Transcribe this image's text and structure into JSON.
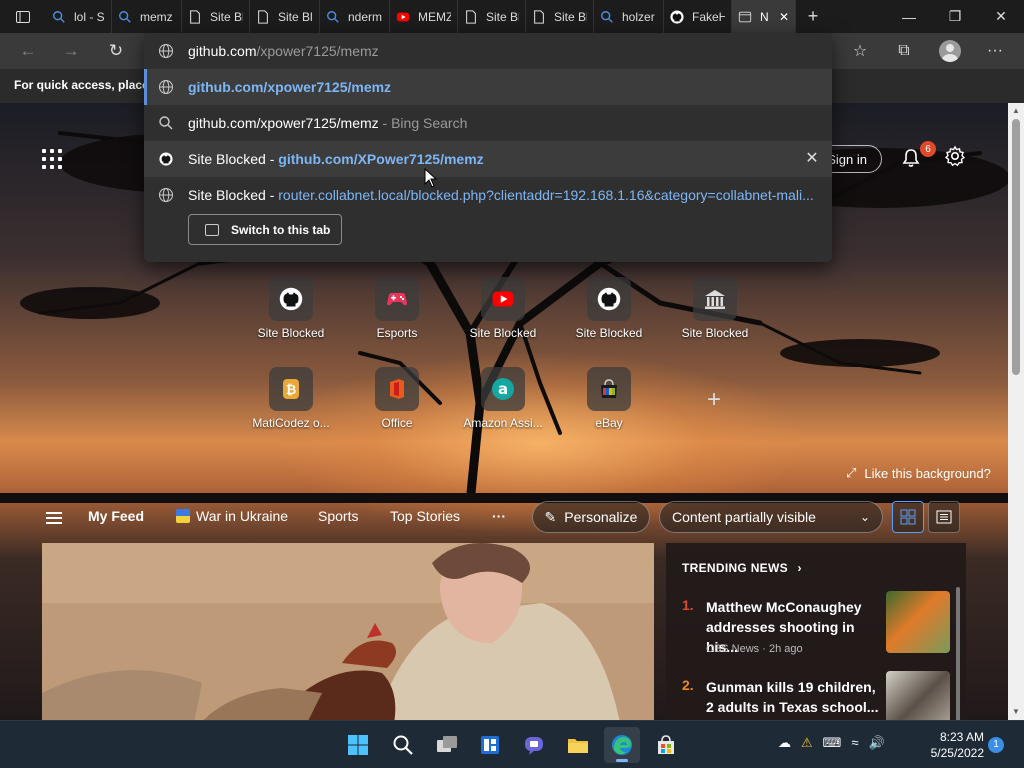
{
  "tabs": [
    {
      "title": "lol - S",
      "icon": "search-icon"
    },
    {
      "title": "memz",
      "icon": "search-icon"
    },
    {
      "title": "Site Bl",
      "icon": "page-icon"
    },
    {
      "title": "Site Bl",
      "icon": "page-icon"
    },
    {
      "title": "nderm",
      "icon": "search-icon"
    },
    {
      "title": "MEMZ",
      "icon": "youtube-icon"
    },
    {
      "title": "Site Bl",
      "icon": "page-icon"
    },
    {
      "title": "Site Bl",
      "icon": "page-icon"
    },
    {
      "title": "holzer",
      "icon": "search-icon"
    },
    {
      "title": "FakeH",
      "icon": "github-icon"
    },
    {
      "title": "N",
      "icon": "newtab-icon",
      "active": true
    }
  ],
  "addressbar": {
    "domain": "github.com",
    "path": "/xpower7125/memz"
  },
  "favorites_bar": {
    "message": "For quick access, place y"
  },
  "suggestions": [
    {
      "text": "github.com/xpower7125/memz",
      "icon": "globe-icon"
    },
    {
      "text": "github.com/xpower7125/memz",
      "suffix": " - Bing Search",
      "icon": "search-icon"
    },
    {
      "prefix": "Site Blocked - ",
      "link": "github.com/XPower7125/memz",
      "icon": "github-icon"
    },
    {
      "prefix": "Site Blocked - ",
      "link": "router.collabnet.local/blocked.php?clientaddr=192.168.1.16&category=collabnet-mali...",
      "icon": "globe-icon"
    }
  ],
  "switch_tab_label": "Switch to this tab",
  "header": {
    "signin": "Sign in",
    "notification_count": "6"
  },
  "quick_links": [
    {
      "label": "Site Blocked",
      "icon": "github-icon"
    },
    {
      "label": "Esports",
      "icon": "gamepad-icon"
    },
    {
      "label": "Site Blocked",
      "icon": "youtube-icon"
    },
    {
      "label": "Site Blocked",
      "icon": "github-icon"
    },
    {
      "label": "Site Blocked",
      "icon": "bank-icon"
    },
    {
      "label": "MatiCodez o...",
      "icon": "bitcoin-icon"
    },
    {
      "label": "Office",
      "icon": "office-icon"
    },
    {
      "label": "Amazon Assi...",
      "icon": "amazon-icon"
    },
    {
      "label": "eBay",
      "icon": "ebay-icon"
    }
  ],
  "like_background": "Like this background?",
  "feed_nav": {
    "my_feed": "My Feed",
    "war": "War in Ukraine",
    "sports": "Sports",
    "top_stories": "Top Stories",
    "more": "···",
    "personalize": "Personalize",
    "content_select": "Content partially visible"
  },
  "trending": {
    "title": "TRENDING NEWS",
    "items": [
      {
        "num": "1.",
        "title": "Matthew McConaughey addresses shooting in his...",
        "source": "CBS News · 2h ago",
        "num_color": "#e04a2a"
      },
      {
        "num": "2.",
        "title": "Gunman kills 19 children, 2 adults in Texas school...",
        "source": "",
        "num_color": "#f08a1a"
      }
    ]
  },
  "taskbar": {
    "time": "8:23 AM",
    "date": "5/25/2022",
    "notifications": "1"
  },
  "colors": {
    "accent": "#5b8fdb",
    "link": "#7eb6f5"
  }
}
